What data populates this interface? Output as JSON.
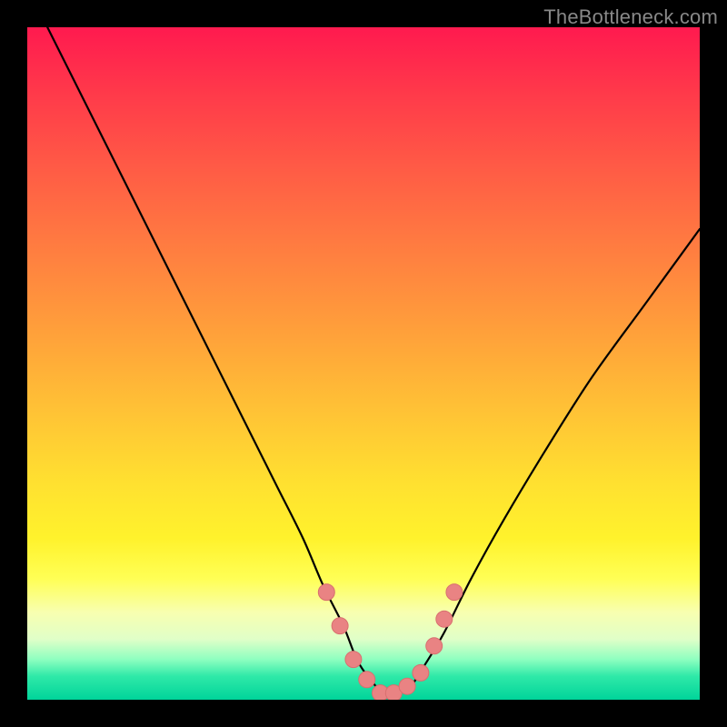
{
  "watermark": "TheBottleneck.com",
  "colors": {
    "background": "#000000",
    "curve": "#000000",
    "dot_fill": "#e98383",
    "dot_stroke": "#d86f6f"
  },
  "chart_data": {
    "type": "line",
    "title": "",
    "xlabel": "",
    "ylabel": "",
    "xlim": [
      0,
      100
    ],
    "ylim": [
      0,
      100
    ],
    "annotations": [
      "TheBottleneck.com"
    ],
    "series": [
      {
        "name": "bottleneck-curve",
        "x": [
          3,
          8,
          14,
          20,
          26,
          32,
          37,
          41,
          44,
          47,
          49,
          51,
          53,
          55,
          57,
          59,
          62,
          66,
          71,
          77,
          84,
          92,
          100
        ],
        "y": [
          100,
          90,
          78,
          66,
          54,
          42,
          32,
          24,
          17,
          11,
          6,
          3,
          1,
          1,
          2,
          5,
          10,
          18,
          27,
          37,
          48,
          59,
          70
        ]
      }
    ],
    "scatter_points": {
      "name": "highlight-dots",
      "x": [
        44.5,
        46.5,
        48.5,
        50.5,
        52.5,
        54.5,
        56.5,
        58.5,
        60.5,
        62.0,
        63.5
      ],
      "y": [
        16,
        11,
        6,
        3,
        1,
        1,
        2,
        4,
        8,
        12,
        16
      ]
    }
  }
}
